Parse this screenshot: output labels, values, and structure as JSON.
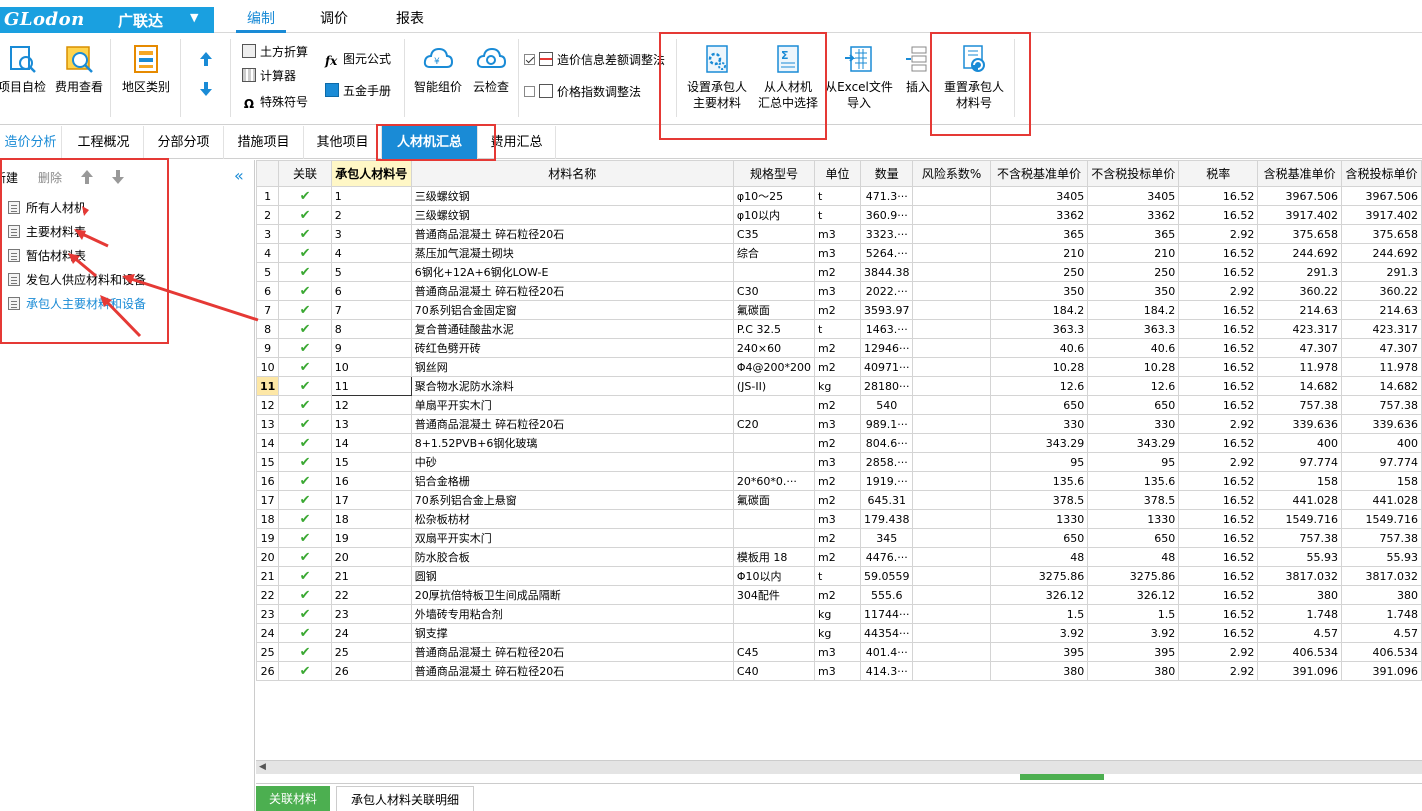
{
  "header": {
    "logo_brand": "GLodon",
    "logo_cn": "广联达",
    "logo_caret": "▼",
    "tabs": [
      "编制",
      "调价",
      "报表"
    ]
  },
  "ribbon": {
    "self_check": "项目自检",
    "fee_view": "费用查看",
    "region": "地区类别",
    "earthwork": "土方折算",
    "calculator": "计算器",
    "special_symbol": "特殊符号",
    "formula": "图元公式",
    "hardware": "五金手册",
    "smart_price": "智能组价",
    "cloud_check": "云检查",
    "price_diff": "造价信息差额调整法",
    "price_index": "价格指数调整法",
    "set_main_l1": "设置承包人",
    "set_main_l2": "主要材料",
    "select_l1": "从人材机",
    "select_l2": "汇总中选择",
    "excel_l1": "从Excel文件",
    "excel_l2": "导入",
    "insert": "插入",
    "reset_l1": "重置承包人",
    "reset_l2": "材料号"
  },
  "page_tabs": [
    "造价分析",
    "工程概况",
    "分部分项",
    "措施项目",
    "其他项目",
    "人材机汇总",
    "费用汇总"
  ],
  "left_panel": {
    "new": "新建",
    "delete": "删除",
    "items": [
      "所有人材机",
      "主要材料表",
      "暂估材料表",
      "发包人供应材料和设备",
      "承包人主要材料和设备"
    ]
  },
  "table": {
    "headers": [
      "关联",
      "承包人材料号",
      "材料名称",
      "规格型号",
      "单位",
      "数量",
      "风险系数%",
      "不含税基准单价",
      "不含税投标单价",
      "税率",
      "含税基准单价",
      "含税投标单价"
    ],
    "check_mark": "✔",
    "rows": [
      [
        "1",
        "1",
        "三级螺纹钢",
        "φ10～25",
        "t",
        "471.3···",
        "",
        "3405",
        "3405",
        "16.52",
        "3967.506",
        "3967.506"
      ],
      [
        "2",
        "2",
        "三级螺纹钢",
        "φ10以内",
        "t",
        "360.9···",
        "",
        "3362",
        "3362",
        "16.52",
        "3917.402",
        "3917.402"
      ],
      [
        "3",
        "3",
        "普通商品混凝土 碎石粒径20石",
        "C35",
        "m3",
        "3323.···",
        "",
        "365",
        "365",
        "2.92",
        "375.658",
        "375.658"
      ],
      [
        "4",
        "4",
        "蒸压加气混凝土砌块",
        "综合",
        "m3",
        "5264.···",
        "",
        "210",
        "210",
        "16.52",
        "244.692",
        "244.692"
      ],
      [
        "5",
        "5",
        "6钢化+12A+6钢化LOW-E",
        "",
        "m2",
        "3844.38",
        "",
        "250",
        "250",
        "16.52",
        "291.3",
        "291.3"
      ],
      [
        "6",
        "6",
        "普通商品混凝土 碎石粒径20石",
        "C30",
        "m3",
        "2022.···",
        "",
        "350",
        "350",
        "2.92",
        "360.22",
        "360.22"
      ],
      [
        "7",
        "7",
        "70系列铝合金固定窗",
        "氟碳面",
        "m2",
        "3593.97",
        "",
        "184.2",
        "184.2",
        "16.52",
        "214.63",
        "214.63"
      ],
      [
        "8",
        "8",
        "复合普通硅酸盐水泥",
        "P.C 32.5",
        "t",
        "1463.···",
        "",
        "363.3",
        "363.3",
        "16.52",
        "423.317",
        "423.317"
      ],
      [
        "9",
        "9",
        "砖红色劈开砖",
        "240×60",
        "m2",
        "12946···",
        "",
        "40.6",
        "40.6",
        "16.52",
        "47.307",
        "47.307"
      ],
      [
        "10",
        "10",
        "钢丝网",
        "Φ4@200*200",
        "m2",
        "40971···",
        "",
        "10.28",
        "10.28",
        "16.52",
        "11.978",
        "11.978"
      ],
      [
        "11",
        "11",
        "聚合物水泥防水涂料",
        "(JS-II)",
        "kg",
        "28180···",
        "",
        "12.6",
        "12.6",
        "16.52",
        "14.682",
        "14.682"
      ],
      [
        "12",
        "12",
        "单扇平开实木门",
        "",
        "m2",
        "540",
        "",
        "650",
        "650",
        "16.52",
        "757.38",
        "757.38"
      ],
      [
        "13",
        "13",
        "普通商品混凝土 碎石粒径20石",
        "C20",
        "m3",
        "989.1···",
        "",
        "330",
        "330",
        "2.92",
        "339.636",
        "339.636"
      ],
      [
        "14",
        "14",
        "8+1.52PVB+6钢化玻璃",
        "",
        "m2",
        "804.6···",
        "",
        "343.29",
        "343.29",
        "16.52",
        "400",
        "400"
      ],
      [
        "15",
        "15",
        "中砂",
        "",
        "m3",
        "2858.···",
        "",
        "95",
        "95",
        "2.92",
        "97.774",
        "97.774"
      ],
      [
        "16",
        "16",
        "铝合金格栅",
        "20*60*0.···",
        "m2",
        "1919.···",
        "",
        "135.6",
        "135.6",
        "16.52",
        "158",
        "158"
      ],
      [
        "17",
        "17",
        "70系列铝合金上悬窗",
        "氟碳面",
        "m2",
        "645.31",
        "",
        "378.5",
        "378.5",
        "16.52",
        "441.028",
        "441.028"
      ],
      [
        "18",
        "18",
        "松杂板枋材",
        "",
        "m3",
        "179.438",
        "",
        "1330",
        "1330",
        "16.52",
        "1549.716",
        "1549.716"
      ],
      [
        "19",
        "19",
        "双扇平开实木门",
        "",
        "m2",
        "345",
        "",
        "650",
        "650",
        "16.52",
        "757.38",
        "757.38"
      ],
      [
        "20",
        "20",
        "防水胶合板",
        "模板用 18",
        "m2",
        "4476.···",
        "",
        "48",
        "48",
        "16.52",
        "55.93",
        "55.93"
      ],
      [
        "21",
        "21",
        "圆钢",
        "Φ10以内",
        "t",
        "59.0559",
        "",
        "3275.86",
        "3275.86",
        "16.52",
        "3817.032",
        "3817.032"
      ],
      [
        "22",
        "22",
        "20厚抗倍特板卫生间成品隔断",
        "304配件",
        "m2",
        "555.6",
        "",
        "326.12",
        "326.12",
        "16.52",
        "380",
        "380"
      ],
      [
        "23",
        "23",
        "外墙砖专用粘合剂",
        "",
        "kg",
        "11744···",
        "",
        "1.5",
        "1.5",
        "16.52",
        "1.748",
        "1.748"
      ],
      [
        "24",
        "24",
        "钢支撑",
        "",
        "kg",
        "44354···",
        "",
        "3.92",
        "3.92",
        "16.52",
        "4.57",
        "4.57"
      ],
      [
        "25",
        "25",
        "普通商品混凝土 碎石粒径20石",
        "C45",
        "m3",
        "401.4···",
        "",
        "395",
        "395",
        "2.92",
        "406.534",
        "406.534"
      ],
      [
        "26",
        "26",
        "普通商品混凝土 碎石粒径20石",
        "C40",
        "m3",
        "414.3···",
        "",
        "380",
        "380",
        "2.92",
        "391.096",
        "391.096"
      ]
    ]
  },
  "bottom_tabs": [
    "关联材料",
    "承包人材料关联明细"
  ],
  "colors": {
    "accent": "#1a8bd6",
    "annotation": "#e53935",
    "check": "#3aa832",
    "bottom_active": "#4caf50"
  }
}
